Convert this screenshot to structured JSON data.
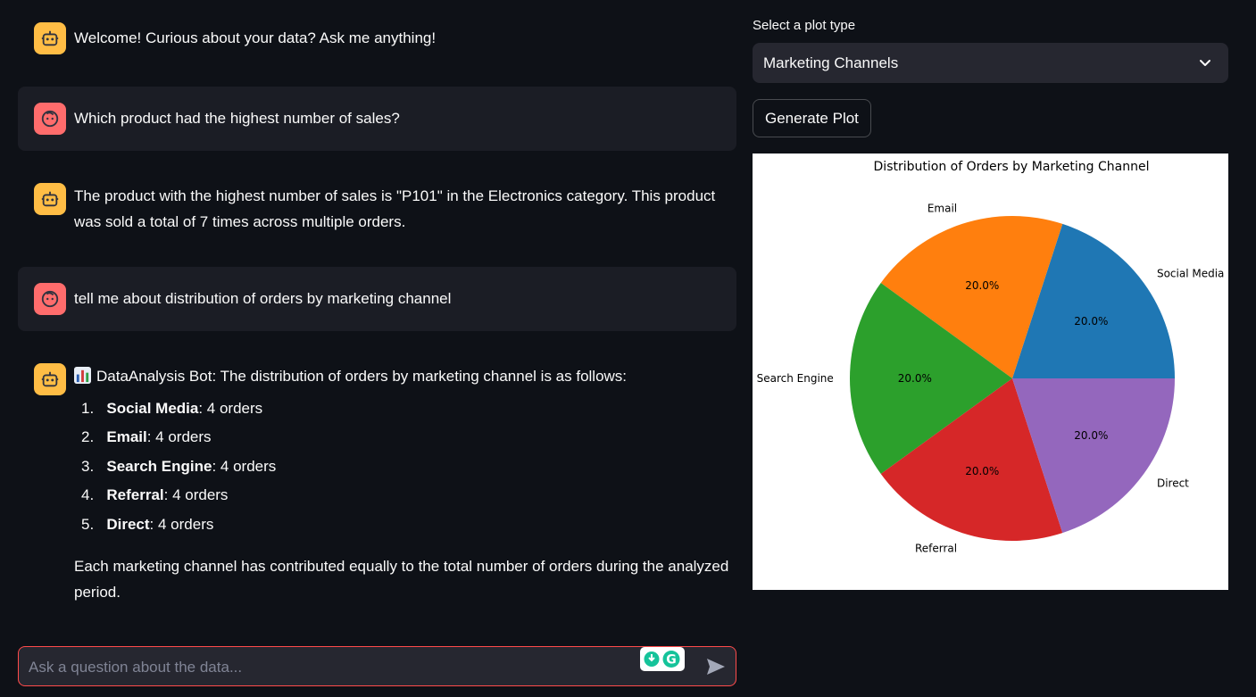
{
  "chat": {
    "messages": [
      {
        "role": "assistant",
        "text": "Welcome! Curious about your data? Ask me anything!"
      },
      {
        "role": "user",
        "text": "Which product had the highest number of sales?"
      },
      {
        "role": "assistant",
        "text": "The product with the highest number of sales is \"P101\" in the Electronics category. This product was sold a total of 7 times across multiple orders."
      },
      {
        "role": "user",
        "text": "tell me about distribution of orders by marketing channel"
      },
      {
        "role": "assistant",
        "intro_icon": "bar-chart-emoji",
        "intro": "DataAnalysis Bot: The distribution of orders by marketing channel is as follows:",
        "list": [
          {
            "num": "1.",
            "name": "Social Media",
            "value": ": 4 orders"
          },
          {
            "num": "2.",
            "name": "Email",
            "value": ": 4 orders"
          },
          {
            "num": "3.",
            "name": "Search Engine",
            "value": ": 4 orders"
          },
          {
            "num": "4.",
            "name": "Referral",
            "value": ": 4 orders"
          },
          {
            "num": "5.",
            "name": "Direct",
            "value": ": 4 orders"
          }
        ],
        "outro": "Each marketing channel has contributed equally to the total number of orders during the analyzed period."
      }
    ],
    "input_placeholder": "Ask a question about the data..."
  },
  "controls": {
    "select_label": "Select a plot type",
    "select_value": "Marketing Channels",
    "generate_label": "Generate Plot"
  },
  "colors": {
    "accent": "#ff4b4b",
    "bot_avatar": "#ffbd45",
    "user_avatar": "#ff6c6c"
  },
  "chart_data": {
    "type": "pie",
    "title": "Distribution of Orders by Marketing Channel",
    "labels": [
      "Social Media",
      "Email",
      "Search Engine",
      "Referral",
      "Direct"
    ],
    "values": [
      4,
      4,
      4,
      4,
      4
    ],
    "percent_labels": [
      "20.0%",
      "20.0%",
      "20.0%",
      "20.0%",
      "20.0%"
    ],
    "colors": [
      "#1f77b4",
      "#ff7f0e",
      "#2ca02c",
      "#d62728",
      "#9467bd"
    ],
    "start_angle": 0
  }
}
